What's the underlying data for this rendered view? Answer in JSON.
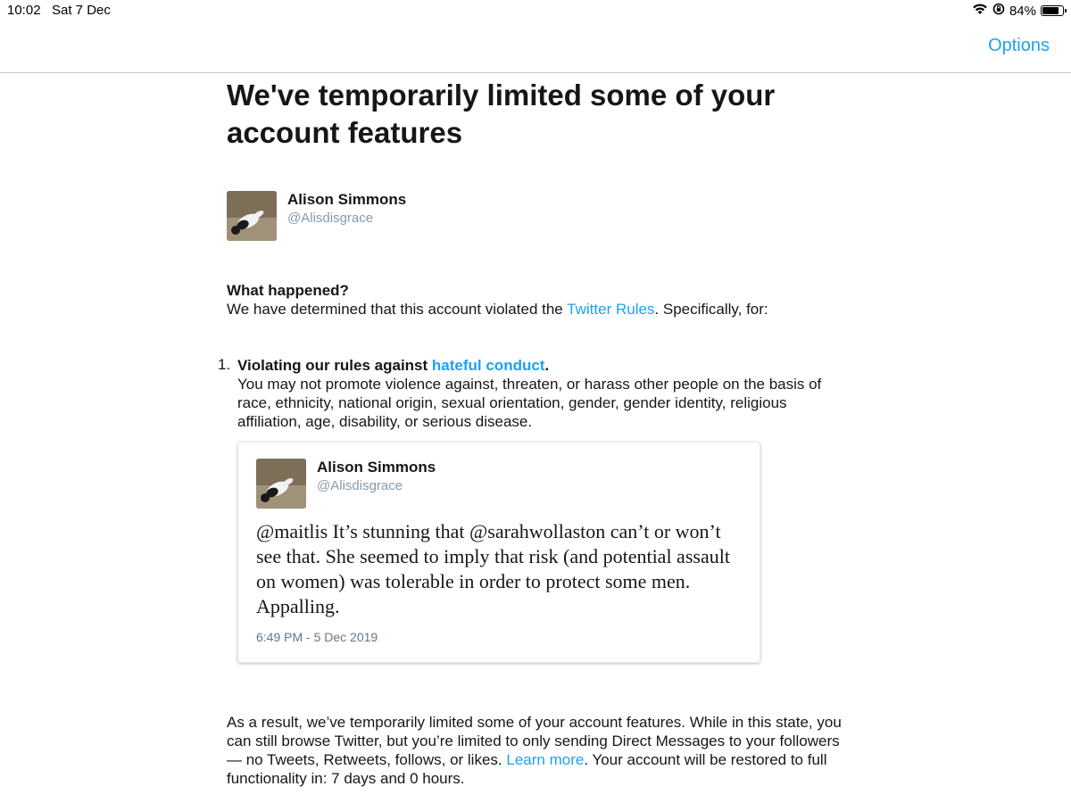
{
  "status_bar": {
    "time": "10:02",
    "date": "Sat 7 Dec",
    "battery": "84%",
    "battery_level": 0.84,
    "icons": [
      "wifi-icon",
      "rotation-lock-icon",
      "battery-icon"
    ]
  },
  "nav": {
    "options_label": "Options"
  },
  "page": {
    "title": "We've temporarily limited some of your account features",
    "user": {
      "name": "Alison Simmons",
      "handle": "@Alisdisgrace"
    },
    "what_happened": {
      "heading": "What happened?",
      "text_before": "We have determined that this account violated the ",
      "link": "Twitter Rules",
      "text_after": ". Specifically, for:"
    },
    "violations": [
      {
        "number": "1.",
        "title_before": "Violating our rules against ",
        "title_link": "hateful conduct",
        "title_after": ".",
        "description": "You may not promote violence against, threaten, or harass other people on the basis of race, ethnicity, national origin, sexual orientation, gender, gender identity, religious affiliation, age, disability, or serious disease."
      }
    ],
    "tweet": {
      "name": "Alison Simmons",
      "handle": "@Alisdisgrace",
      "text": "@maitlis It’s stunning that @sarahwollaston can’t or won’t see that. She seemed to imply that risk (and potential assault on women) was tolerable in order to protect some men. Appalling.",
      "timestamp": "6:49 PM - 5 Dec 2019"
    },
    "result": {
      "text_before": "As a result, we’ve temporarily limited some of your account features. While in this state, you can still browse Twitter, but you’re limited to only sending Direct Messages to your followers — no Tweets, Retweets, follows, or likes. ",
      "link": "Learn more",
      "text_after": ". Your account will be restored to full functionality in: 7 days and 0 hours."
    }
  },
  "colors": {
    "link": "#1da1f2",
    "text": "#14171a",
    "secondary": "#8899a6"
  }
}
